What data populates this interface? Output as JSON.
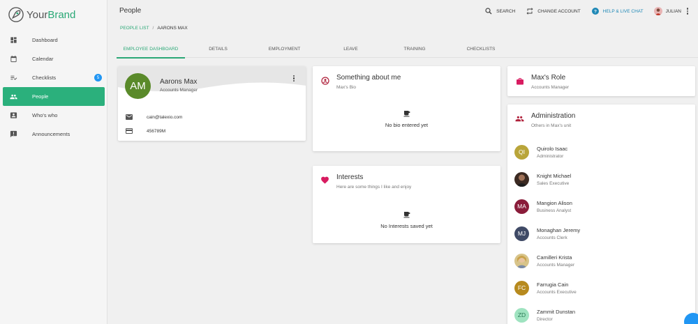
{
  "brand": {
    "name_prefix": "Your",
    "name_suffix": "Brand"
  },
  "sidebar": {
    "items": [
      {
        "label": "Dashboard",
        "icon": "dashboard-icon"
      },
      {
        "label": "Calendar",
        "icon": "calendar-icon"
      },
      {
        "label": "Checklists",
        "icon": "checklist-icon",
        "badge": "5"
      },
      {
        "label": "People",
        "icon": "people-icon",
        "active": true
      },
      {
        "label": "Who's who",
        "icon": "contact-card-icon"
      },
      {
        "label": "Announcements",
        "icon": "announcement-icon"
      }
    ]
  },
  "header": {
    "title": "People",
    "actions": {
      "search": "SEARCH",
      "change_account": "CHANGE ACCOUNT",
      "help": "HELP & LIVE CHAT",
      "user": "JULIAN"
    }
  },
  "breadcrumb": {
    "root": "PEOPLE LIST",
    "separator": "/",
    "current": "AARONS MAX"
  },
  "tabs": [
    "EMPLOYEE DASHBOARD",
    "DETAILS",
    "EMPLOYMENT",
    "LEAVE",
    "TRAINING",
    "CHECKLISTS"
  ],
  "profile": {
    "initials": "AM",
    "name": "Aarons Max",
    "role": "Accounts Manager",
    "email": "cain@talexio.com",
    "card_number": "456789M"
  },
  "bio": {
    "title": "Something about me",
    "subtitle": "Max's Bio",
    "empty": "No bio entered yet"
  },
  "interests": {
    "title": "Interests",
    "subtitle": "Here are some things I like and enjoy",
    "empty": "No Interests saved yet"
  },
  "role_card": {
    "title": "Max's Role",
    "subtitle": "Accounts Manager"
  },
  "administration": {
    "title": "Administration",
    "subtitle": "Others in Max's unit",
    "members": [
      {
        "initials": "QI",
        "name": "Quirolo Isaac",
        "role": "Administrator",
        "color": "#b9a53a"
      },
      {
        "initials": "",
        "name": "Knight Michael",
        "role": "Sales Executive",
        "color": "#3b2a22"
      },
      {
        "initials": "MA",
        "name": "Mangion Alison",
        "role": "Business Analyst",
        "color": "#8a1c3a"
      },
      {
        "initials": "MJ",
        "name": "Monaghan Jeremy",
        "role": "Accounts Clerk",
        "color": "#3f4a66"
      },
      {
        "initials": "",
        "name": "Camilleri Krista",
        "role": "Accounts Manager",
        "color": "#d8c48a"
      },
      {
        "initials": "FC",
        "name": "Farrugia Cain",
        "role": "Accounts Executive",
        "color": "#b78a1e"
      },
      {
        "initials": "ZD",
        "name": "Zammit Dunstan",
        "role": "Director",
        "color": "#9fe3c0"
      }
    ]
  },
  "colors": {
    "accent": "#2aa876",
    "active_nav": "#2bb07c",
    "badge": "#2196f3",
    "help": "#1e88b6"
  }
}
